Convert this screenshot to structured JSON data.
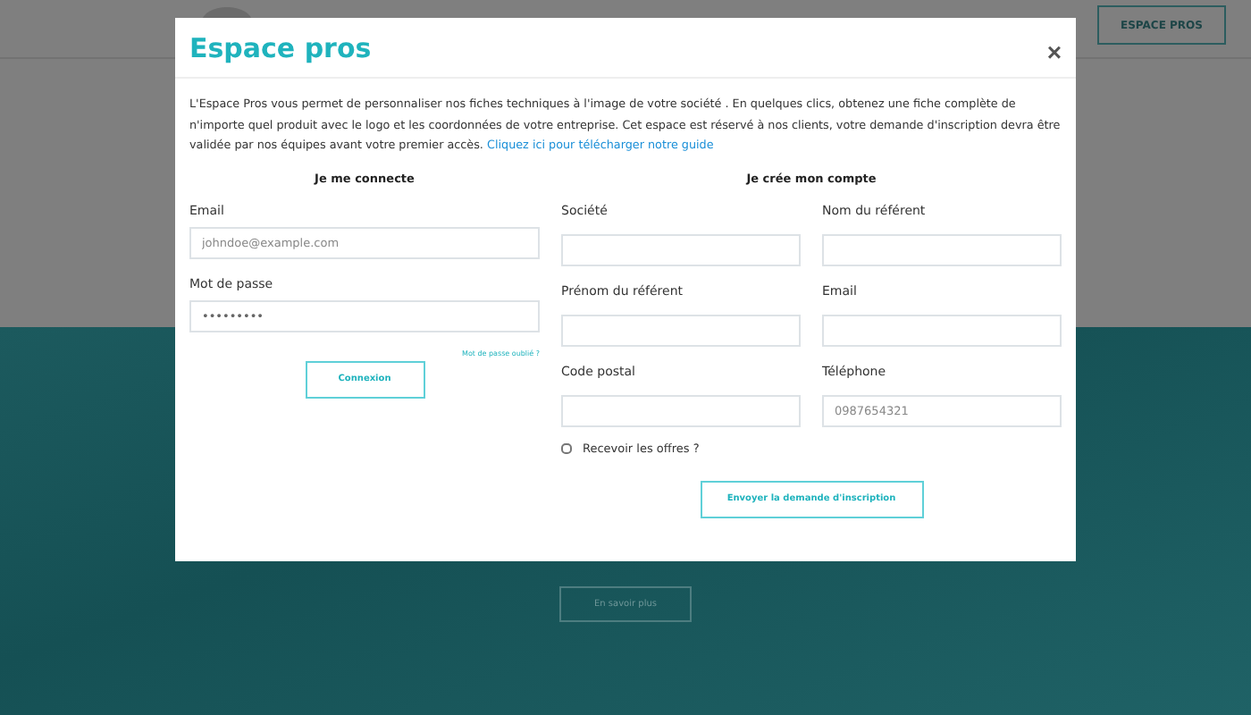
{
  "page": {
    "header_button": "ESPACE PROS",
    "more_button": "En savoir plus"
  },
  "modal": {
    "title": "Espace pros",
    "close": "×",
    "intro": "L'Espace Pros vous permet de personnaliser nos fiches techniques à l'image de votre société . En quelques clics, obtenez une fiche complète de n'importe quel produit avec le logo et les coordonnées de votre entreprise. Cet espace est réservé à nos clients, votre demande d'inscription devra être validée par nos équipes avant votre premier accès.",
    "guide_link": "Cliquez ici pour télécharger notre guide",
    "login": {
      "heading": "Je me connecte",
      "fields": [
        {
          "label": "Email",
          "placeholder": "johndoe@example.com"
        },
        {
          "label": "Mot de passe",
          "value": "•••••••••"
        }
      ],
      "forgot_link": "Mot de passe oublié ?",
      "submit": "Connexion"
    },
    "register": {
      "heading": "Je crée mon compte",
      "fields": [
        {
          "label": "Société"
        },
        {
          "label": "Nom du référent"
        },
        {
          "label": "Prénom du référent"
        },
        {
          "label": "Email"
        },
        {
          "label": "Code postal"
        },
        {
          "label": "Téléphone",
          "placeholder": "0987654321"
        }
      ],
      "offers": {
        "label": "Recevoir les offres ?",
        "checked": false
      },
      "submit": "Envoyer la demande d'inscription"
    }
  }
}
